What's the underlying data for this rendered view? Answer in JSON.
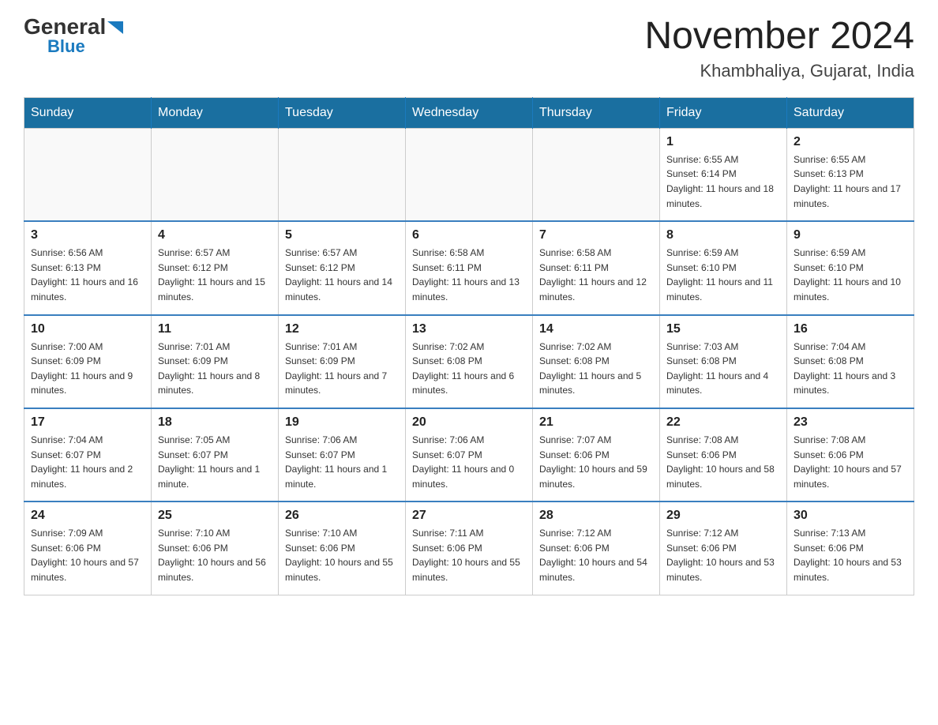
{
  "logo": {
    "general": "General",
    "blue": "Blue",
    "triangle": "▲"
  },
  "title": "November 2024",
  "subtitle": "Khambhaliya, Gujarat, India",
  "days_of_week": [
    "Sunday",
    "Monday",
    "Tuesday",
    "Wednesday",
    "Thursday",
    "Friday",
    "Saturday"
  ],
  "weeks": [
    [
      {
        "day": "",
        "info": ""
      },
      {
        "day": "",
        "info": ""
      },
      {
        "day": "",
        "info": ""
      },
      {
        "day": "",
        "info": ""
      },
      {
        "day": "",
        "info": ""
      },
      {
        "day": "1",
        "info": "Sunrise: 6:55 AM\nSunset: 6:14 PM\nDaylight: 11 hours and 18 minutes."
      },
      {
        "day": "2",
        "info": "Sunrise: 6:55 AM\nSunset: 6:13 PM\nDaylight: 11 hours and 17 minutes."
      }
    ],
    [
      {
        "day": "3",
        "info": "Sunrise: 6:56 AM\nSunset: 6:13 PM\nDaylight: 11 hours and 16 minutes."
      },
      {
        "day": "4",
        "info": "Sunrise: 6:57 AM\nSunset: 6:12 PM\nDaylight: 11 hours and 15 minutes."
      },
      {
        "day": "5",
        "info": "Sunrise: 6:57 AM\nSunset: 6:12 PM\nDaylight: 11 hours and 14 minutes."
      },
      {
        "day": "6",
        "info": "Sunrise: 6:58 AM\nSunset: 6:11 PM\nDaylight: 11 hours and 13 minutes."
      },
      {
        "day": "7",
        "info": "Sunrise: 6:58 AM\nSunset: 6:11 PM\nDaylight: 11 hours and 12 minutes."
      },
      {
        "day": "8",
        "info": "Sunrise: 6:59 AM\nSunset: 6:10 PM\nDaylight: 11 hours and 11 minutes."
      },
      {
        "day": "9",
        "info": "Sunrise: 6:59 AM\nSunset: 6:10 PM\nDaylight: 11 hours and 10 minutes."
      }
    ],
    [
      {
        "day": "10",
        "info": "Sunrise: 7:00 AM\nSunset: 6:09 PM\nDaylight: 11 hours and 9 minutes."
      },
      {
        "day": "11",
        "info": "Sunrise: 7:01 AM\nSunset: 6:09 PM\nDaylight: 11 hours and 8 minutes."
      },
      {
        "day": "12",
        "info": "Sunrise: 7:01 AM\nSunset: 6:09 PM\nDaylight: 11 hours and 7 minutes."
      },
      {
        "day": "13",
        "info": "Sunrise: 7:02 AM\nSunset: 6:08 PM\nDaylight: 11 hours and 6 minutes."
      },
      {
        "day": "14",
        "info": "Sunrise: 7:02 AM\nSunset: 6:08 PM\nDaylight: 11 hours and 5 minutes."
      },
      {
        "day": "15",
        "info": "Sunrise: 7:03 AM\nSunset: 6:08 PM\nDaylight: 11 hours and 4 minutes."
      },
      {
        "day": "16",
        "info": "Sunrise: 7:04 AM\nSunset: 6:08 PM\nDaylight: 11 hours and 3 minutes."
      }
    ],
    [
      {
        "day": "17",
        "info": "Sunrise: 7:04 AM\nSunset: 6:07 PM\nDaylight: 11 hours and 2 minutes."
      },
      {
        "day": "18",
        "info": "Sunrise: 7:05 AM\nSunset: 6:07 PM\nDaylight: 11 hours and 1 minute."
      },
      {
        "day": "19",
        "info": "Sunrise: 7:06 AM\nSunset: 6:07 PM\nDaylight: 11 hours and 1 minute."
      },
      {
        "day": "20",
        "info": "Sunrise: 7:06 AM\nSunset: 6:07 PM\nDaylight: 11 hours and 0 minutes."
      },
      {
        "day": "21",
        "info": "Sunrise: 7:07 AM\nSunset: 6:06 PM\nDaylight: 10 hours and 59 minutes."
      },
      {
        "day": "22",
        "info": "Sunrise: 7:08 AM\nSunset: 6:06 PM\nDaylight: 10 hours and 58 minutes."
      },
      {
        "day": "23",
        "info": "Sunrise: 7:08 AM\nSunset: 6:06 PM\nDaylight: 10 hours and 57 minutes."
      }
    ],
    [
      {
        "day": "24",
        "info": "Sunrise: 7:09 AM\nSunset: 6:06 PM\nDaylight: 10 hours and 57 minutes."
      },
      {
        "day": "25",
        "info": "Sunrise: 7:10 AM\nSunset: 6:06 PM\nDaylight: 10 hours and 56 minutes."
      },
      {
        "day": "26",
        "info": "Sunrise: 7:10 AM\nSunset: 6:06 PM\nDaylight: 10 hours and 55 minutes."
      },
      {
        "day": "27",
        "info": "Sunrise: 7:11 AM\nSunset: 6:06 PM\nDaylight: 10 hours and 55 minutes."
      },
      {
        "day": "28",
        "info": "Sunrise: 7:12 AM\nSunset: 6:06 PM\nDaylight: 10 hours and 54 minutes."
      },
      {
        "day": "29",
        "info": "Sunrise: 7:12 AM\nSunset: 6:06 PM\nDaylight: 10 hours and 53 minutes."
      },
      {
        "day": "30",
        "info": "Sunrise: 7:13 AM\nSunset: 6:06 PM\nDaylight: 10 hours and 53 minutes."
      }
    ]
  ]
}
